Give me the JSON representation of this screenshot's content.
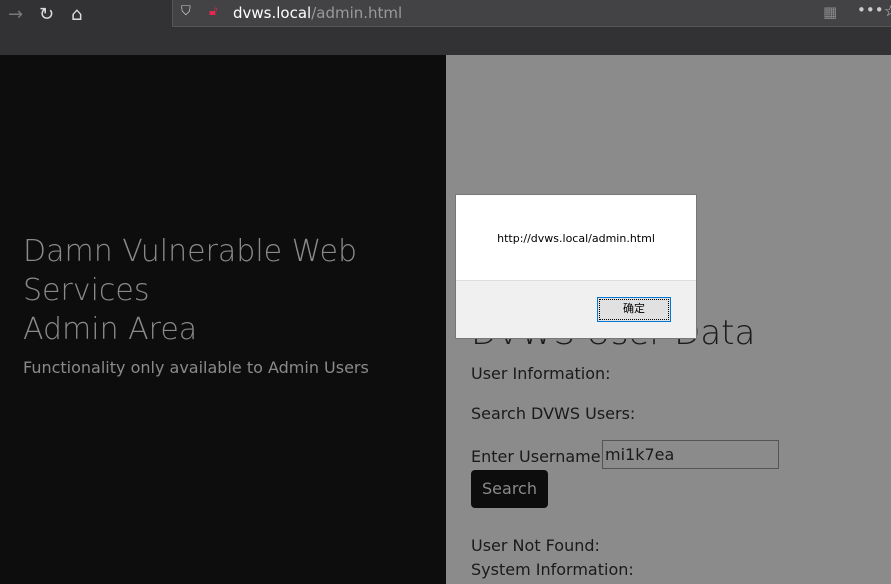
{
  "browser": {
    "url_host": "dvws.local",
    "url_path": "/admin.html"
  },
  "left": {
    "title_line1": "Damn Vulnerable Web",
    "title_line2": "Services",
    "title_line3": "Admin Area",
    "subtitle": "Functionality only available to Admin Users"
  },
  "main": {
    "heading": "DVWS User Data",
    "user_info": "User Information:",
    "search_label": "Search DVWS Users:",
    "username_label": "Enter Username:",
    "username_value": "mi1k7ea",
    "search_button": "Search",
    "not_found": "User Not Found:",
    "system_info": "System Information:"
  },
  "dialog": {
    "message": "http://dvws.local/admin.html",
    "ok": "确定"
  }
}
